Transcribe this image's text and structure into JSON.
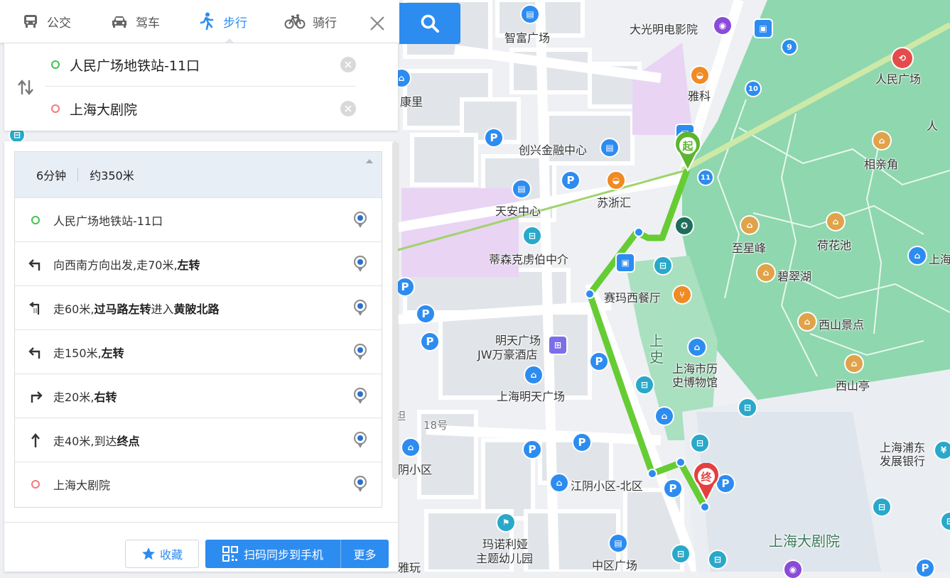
{
  "tabs": [
    {
      "label": "公交",
      "icon": "bus-icon",
      "active": false
    },
    {
      "label": "驾车",
      "icon": "car-icon",
      "active": false
    },
    {
      "label": "步行",
      "icon": "walk-icon",
      "active": true
    },
    {
      "label": "骑行",
      "icon": "bike-icon",
      "active": false
    }
  ],
  "route": {
    "start": "人民广场地铁站-11口",
    "end": "上海大剧院"
  },
  "summary": {
    "time": "6分钟",
    "distance": "约350米"
  },
  "steps": {
    "start": "人民广场地铁站-11口",
    "s1_pre": "向西南方向出发,走70米,",
    "s1_bold": "左转",
    "s2_pre": "走60米,",
    "s2_bold": "过马路左转",
    "s2_mid": "进入",
    "s2_bold2": "黄陂北路",
    "s3_pre": "走150米,",
    "s3_bold": "左转",
    "s4_pre": "走20米,",
    "s4_bold": "右转",
    "s5_pre": "走40米,到达",
    "s5_bold": "终点",
    "end": "上海大剧院"
  },
  "buttons": {
    "favorite": "收藏",
    "sync": "扫码同步到手机",
    "more": "更多"
  },
  "map": {
    "start_marker": "起",
    "end_marker": "终",
    "labels": {
      "l1": "智富广场",
      "l2": "大光明电影院",
      "l3": "人民广场",
      "l4": "雅科",
      "l5": "创兴金融中心",
      "l6": "相亲角",
      "l7": "苏浙汇",
      "l8": "天安中心",
      "l9": "至星峰",
      "l10": "荷花池",
      "l11": "蒂森克虏伯中介",
      "l12": "碧翠湖",
      "l13": "赛玛西餐厅",
      "l14": "西山景点",
      "l15": "明天广场",
      "l16": "JW万豪酒店",
      "l17": "上海市历",
      "l18": "史博物馆",
      "l19": "西山亭",
      "l20": "上海明天广场",
      "l21": "18号",
      "l22": "上海浦东",
      "l23": "发展银行",
      "l24": "阴小区",
      "l25": "江阴小区-北区",
      "l26": "玛诺利娅",
      "l27": "主题幼儿园",
      "l28": "中区广场",
      "l29": "上海大剧院",
      "l30": "康里",
      "l31": "上海",
      "l32": "人",
      "l33": "上",
      "l34": "史",
      "l35": "雅玩",
      "l36": "坦"
    },
    "badges": {
      "b9": "9",
      "b10": "10",
      "b11": "11"
    }
  },
  "colors": {
    "accent": "#2d8cf0",
    "route": "#66cc33",
    "park": "#8fd7ae",
    "start_green": "#5cb531",
    "end_red": "#e53f3f"
  }
}
